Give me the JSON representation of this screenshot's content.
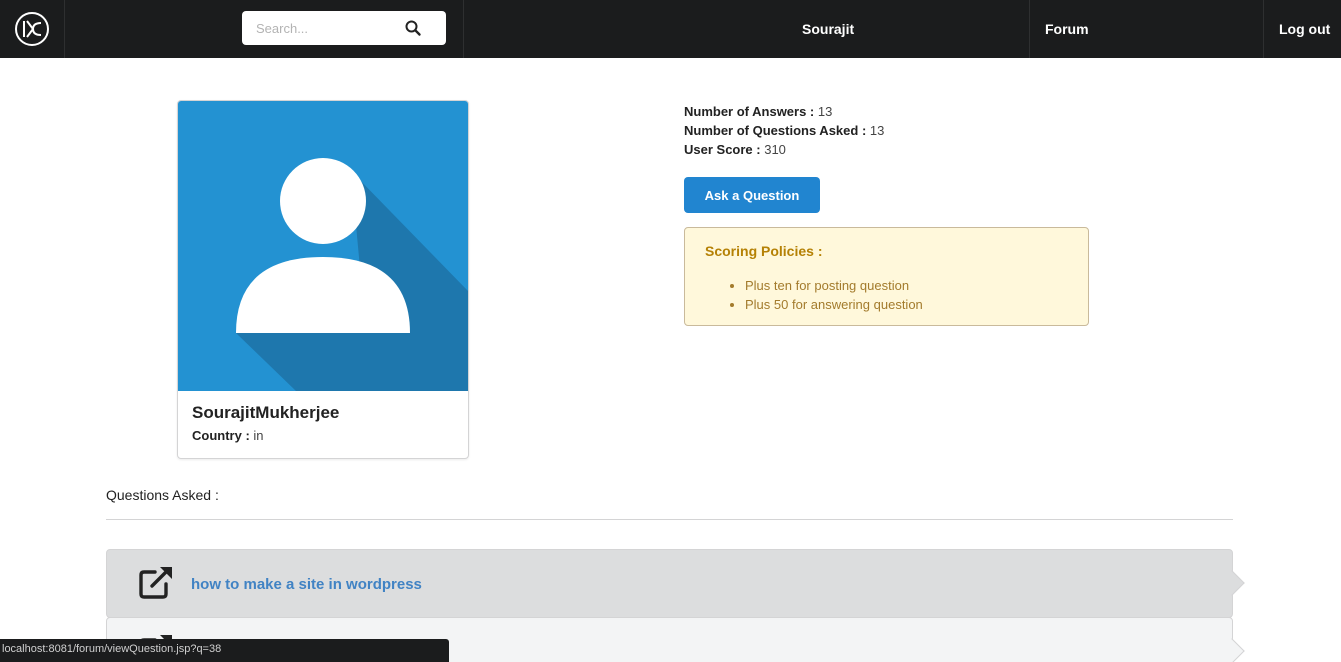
{
  "nav": {
    "search_placeholder": "Search...",
    "user_label": "Sourajit",
    "forum_label": "Forum",
    "logout_label": "Log out"
  },
  "profile": {
    "name": "SourajitMukherjee",
    "country_label": "Country :",
    "country_value": "in"
  },
  "stats": {
    "answers_label": "Number of Answers :",
    "answers_value": "13",
    "questions_label": "Number of Questions Asked :",
    "questions_value": "13",
    "score_label": "User Score :",
    "score_value": "310"
  },
  "ask_button": "Ask a Question",
  "policy": {
    "title": "Scoring Policies :",
    "items": [
      "Plus ten for posting question",
      "Plus 50 for answering question"
    ]
  },
  "questions": {
    "heading": "Questions Asked :",
    "items": [
      {
        "title": "how to make a site in wordpress"
      },
      {
        "title": ""
      }
    ]
  },
  "status_bar": "localhost:8081/forum/viewQuestion.jsp?q=38",
  "colors": {
    "navbar": "#1b1c1d",
    "primary": "#2185d0",
    "link": "#4183c4",
    "warning_bg": "#fff8db",
    "warning_text": "#b58105",
    "avatar_bg": "#2392d2"
  }
}
